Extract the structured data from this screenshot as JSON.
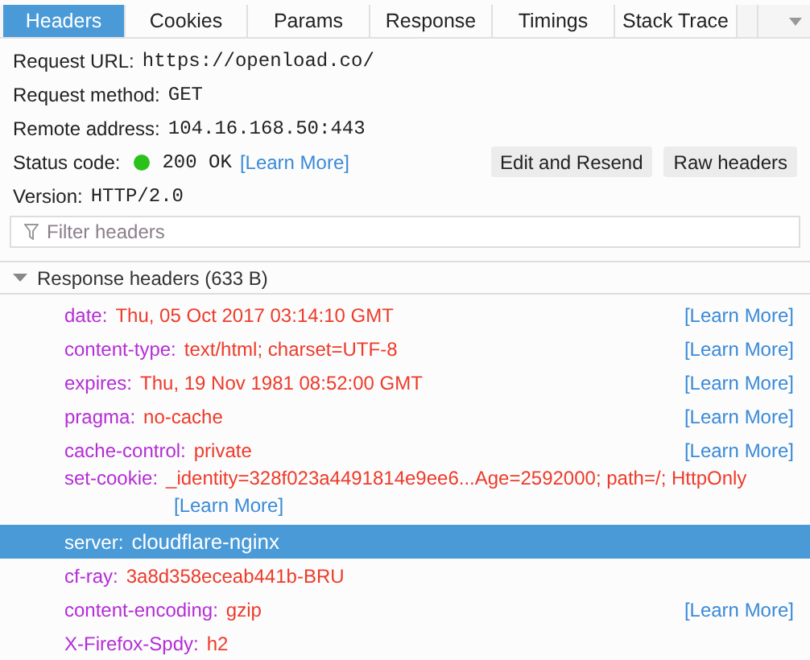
{
  "tabs": [
    {
      "label": "Headers",
      "selected": true
    },
    {
      "label": "Cookies",
      "selected": false
    },
    {
      "label": "Params",
      "selected": false
    },
    {
      "label": "Response",
      "selected": false
    },
    {
      "label": "Timings",
      "selected": false
    },
    {
      "label": "Stack Trace",
      "selected": false
    }
  ],
  "summary": [
    {
      "label": "Request URL:",
      "value": "https://openload.co/"
    },
    {
      "label": "Request method:",
      "value": "GET"
    },
    {
      "label": "Remote address:",
      "value": "104.16.168.50:443"
    },
    {
      "label": "Status code:",
      "value": "200 OK",
      "color": "#2bc11b",
      "learn_more": "[Learn More]"
    },
    {
      "label": "Version:",
      "value": "HTTP/2.0"
    }
  ],
  "buttons": [
    "Edit and Resend",
    "Raw headers"
  ],
  "filter": {
    "placeholder": "Filter headers"
  },
  "section": {
    "title": "Response headers (633 B)",
    "expanded": true
  },
  "headers": [
    {
      "name": "date:",
      "value": "Thu, 05 Oct 2017 03:14:10 GMT",
      "learn_more": "[Learn More]",
      "kind": "inline",
      "selected": false
    },
    {
      "name": "content-type:",
      "value": "text/html; charset=UTF-8",
      "learn_more": "[Learn More]",
      "kind": "inline",
      "selected": false
    },
    {
      "name": "expires:",
      "value": "Thu, 19 Nov 1981 08:52:00 GMT",
      "learn_more": "[Learn More]",
      "kind": "inline",
      "selected": false
    },
    {
      "name": "pragma:",
      "value": "no-cache",
      "learn_more": "[Learn More]",
      "kind": "inline",
      "selected": false
    },
    {
      "name": "cache-control:",
      "value": "private",
      "learn_more": "[Learn More]",
      "kind": "inline",
      "selected": false
    },
    {
      "name": "set-cookie:",
      "value": "_identity=328f023a4491814e9ee6...Age=2592000; path=/; HttpOnly",
      "learn_more": "[Learn More]",
      "kind": "wrapped",
      "selected": false
    },
    {
      "name": "server:",
      "value": "cloudflare-nginx",
      "kind": "inline",
      "selected": true
    },
    {
      "name": "cf-ray:",
      "value": "3a8d358eceab441b-BRU",
      "kind": "inline",
      "selected": false
    },
    {
      "name": "content-encoding:",
      "value": "gzip",
      "learn_more": "[Learn More]",
      "kind": "inline",
      "selected": false
    },
    {
      "name": "X-Firefox-Spdy:",
      "value": "h2",
      "kind": "inline",
      "selected": false
    }
  ]
}
